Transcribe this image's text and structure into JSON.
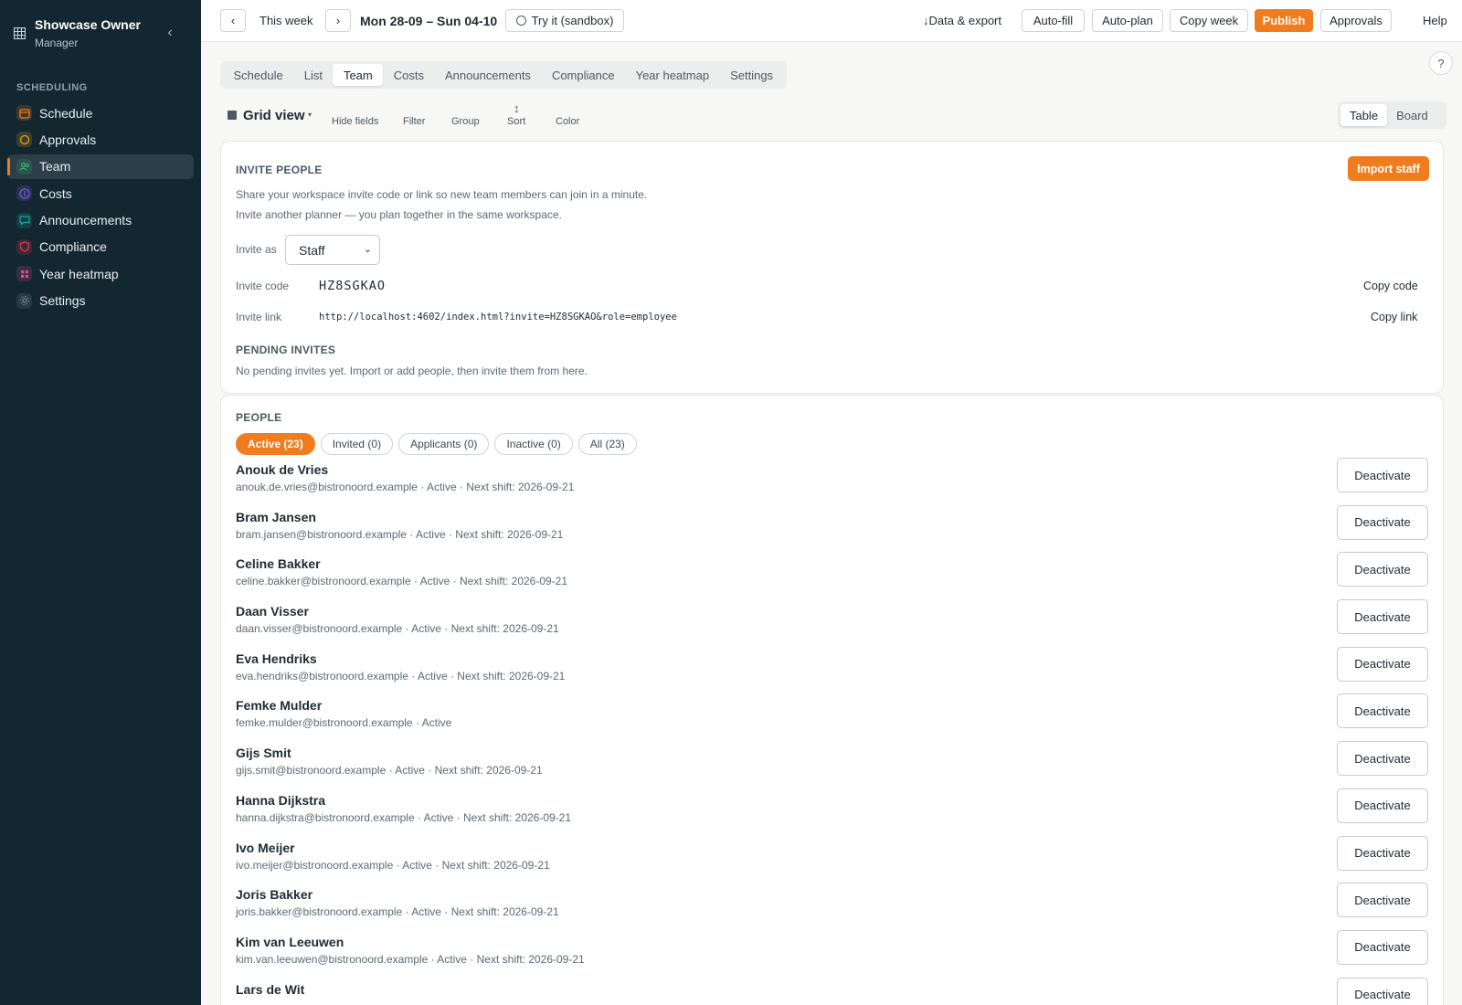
{
  "sidebar": {
    "owner_name": "Showcase Owner",
    "owner_role": "Manager",
    "collapse_icon": "chevron-left-icon",
    "section_label": "SCHEDULING",
    "items": [
      {
        "label": "Schedule",
        "icon": "calendar-icon",
        "color": "#f07c1d",
        "active": false
      },
      {
        "label": "Approvals",
        "icon": "chat-bubble-icon",
        "color": "#e3a21a",
        "active": false
      },
      {
        "label": "Team",
        "icon": "users-icon",
        "color": "#2fb36b",
        "active": true
      },
      {
        "label": "Costs",
        "icon": "coin-icon",
        "color": "#7b5ce0",
        "active": false
      },
      {
        "label": "Announcements",
        "icon": "message-icon",
        "color": "#1fa6a0",
        "active": false
      },
      {
        "label": "Compliance",
        "icon": "shield-icon",
        "color": "#e0384a",
        "active": false
      },
      {
        "label": "Year heatmap",
        "icon": "heatmap-icon",
        "color": "#d94c8a",
        "active": false
      },
      {
        "label": "Settings",
        "icon": "gear-icon",
        "color": "#6f8791",
        "active": false
      }
    ]
  },
  "topbar": {
    "prev": "‹",
    "this_week": "This week",
    "next": "›",
    "range": "Mon 28-09 – Sun 04-10",
    "sandbox": "Try it (sandbox)",
    "data_export": "Data & export",
    "auto_fill": "Auto-fill",
    "auto_plan": "Auto-plan",
    "copy_week": "Copy week",
    "publish": "Publish",
    "approvals": "Approvals",
    "help": "Help"
  },
  "tabs": [
    "Schedule",
    "List",
    "Team",
    "Costs",
    "Announcements",
    "Compliance",
    "Year heatmap",
    "Settings"
  ],
  "active_tab": "Team",
  "help_circle": "?",
  "gridview": {
    "title": "Grid view",
    "caret": "▾",
    "hide_fields": "Hide fields",
    "filter": "Filter",
    "group": "Group",
    "sort": "Sort",
    "color": "Color",
    "view_table": "Table",
    "view_board": "Board"
  },
  "invite": {
    "heading": "INVITE PEOPLE",
    "import_button": "Import staff",
    "line1": "Share your workspace invite code or link so new team members can join in a minute.",
    "line2": "Invite another planner — you plan together in the same workspace.",
    "invite_as_label": "Invite as",
    "invite_as_value": "Staff",
    "code_label": "Invite code",
    "code_value": "HZ8SGKAO",
    "copy_code": "Copy code",
    "link_label": "Invite link",
    "link_value": "http://localhost:4602/index.html?invite=HZ8SGKAO&role=employee",
    "copy_link": "Copy link",
    "pending_heading": "PENDING INVITES",
    "pending_text": "No pending invites yet. Import or add people, then invite them from here."
  },
  "people": {
    "heading": "PEOPLE",
    "filters": [
      "Active (23)",
      "Invited (0)",
      "Applicants (0)",
      "Inactive (0)",
      "All (23)"
    ],
    "active_filter": "Active (23)",
    "deactivate_label": "Deactivate",
    "list": [
      {
        "name": "Anouk de Vries",
        "meta": "anouk.de.vries@bistronoord.example · Active · Next shift: 2026-09-21"
      },
      {
        "name": "Bram Jansen",
        "meta": "bram.jansen@bistronoord.example · Active · Next shift: 2026-09-21"
      },
      {
        "name": "Celine Bakker",
        "meta": "celine.bakker@bistronoord.example · Active · Next shift: 2026-09-21"
      },
      {
        "name": "Daan Visser",
        "meta": "daan.visser@bistronoord.example · Active · Next shift: 2026-09-21"
      },
      {
        "name": "Eva Hendriks",
        "meta": "eva.hendriks@bistronoord.example · Active · Next shift: 2026-09-21"
      },
      {
        "name": "Femke Mulder",
        "meta": "femke.mulder@bistronoord.example · Active"
      },
      {
        "name": "Gijs Smit",
        "meta": "gijs.smit@bistronoord.example · Active · Next shift: 2026-09-21"
      },
      {
        "name": "Hanna Dijkstra",
        "meta": "hanna.dijkstra@bistronoord.example · Active · Next shift: 2026-09-21"
      },
      {
        "name": "Ivo Meijer",
        "meta": "ivo.meijer@bistronoord.example · Active · Next shift: 2026-09-21"
      },
      {
        "name": "Joris Bakker",
        "meta": "joris.bakker@bistronoord.example · Active · Next shift: 2026-09-21"
      },
      {
        "name": "Kim van Leeuwen",
        "meta": "kim.van.leeuwen@bistronoord.example · Active · Next shift: 2026-09-21"
      },
      {
        "name": "Lars de Wit",
        "meta": ""
      }
    ]
  },
  "colors": {
    "accent": "#f07c1d",
    "sidebar_bg": "#132731"
  }
}
